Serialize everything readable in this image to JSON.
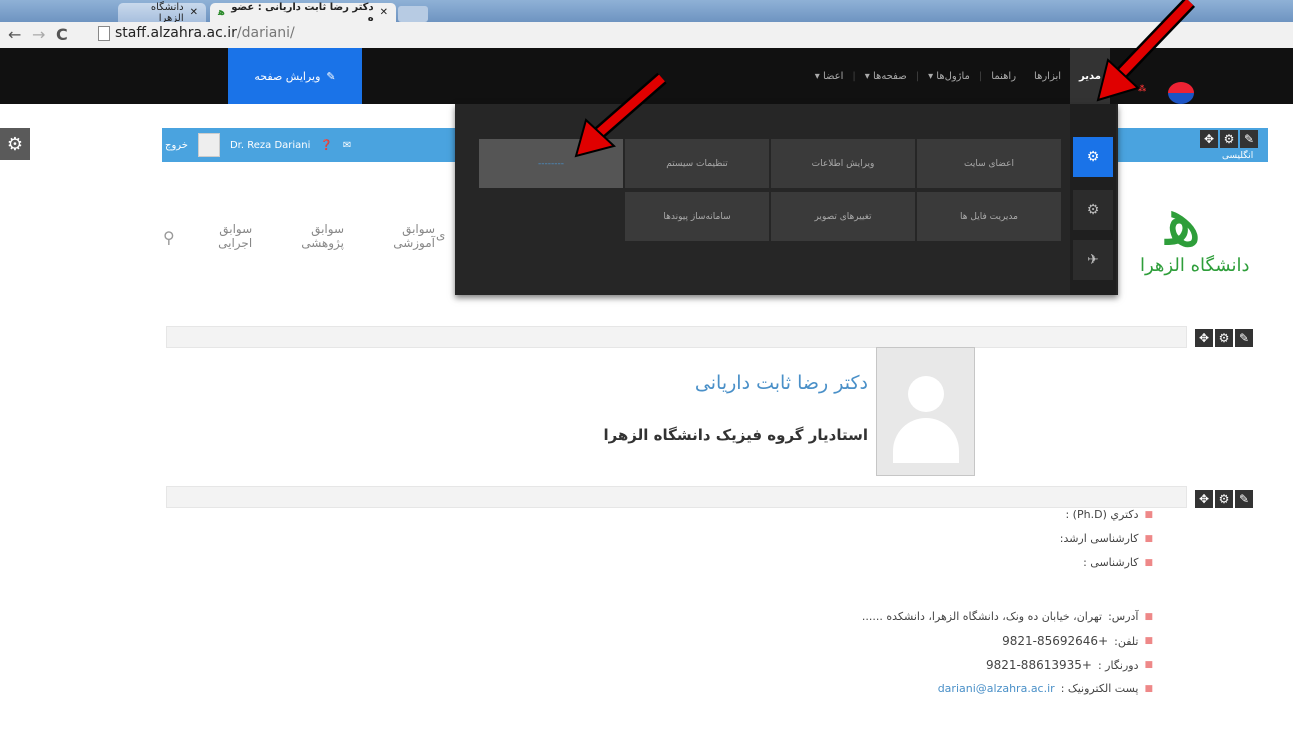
{
  "browser": {
    "tabs": [
      {
        "label": "دانشگاه الزهرا",
        "active": false
      },
      {
        "label": "دکتر رضا ثابت داریانی : عضو ه",
        "active": true
      }
    ],
    "url_domain": "staff.alzahra.ac.ir",
    "url_path": "/dariani/"
  },
  "adminbar": {
    "edit_page_label": "ویرایش صفحه",
    "menu": [
      "مدیر",
      "ابزارها",
      "راهنما",
      "ماژول‌ها",
      "صفحه‌ها",
      "اعضا"
    ],
    "active_item": "مدیر"
  },
  "userbar": {
    "logout": "خروج",
    "username": "Dr. Reza Dariani",
    "lang": "انگلیسی"
  },
  "dropdown": {
    "row1": [
      "اعضای سایت",
      "ویرایش اطلاعات",
      "تنظیمات سیستم",
      "--------"
    ],
    "row2": [
      "مدیریت فایل ها",
      "تغییرهای تصویر",
      "سامانه‌ساز پیوندها"
    ]
  },
  "site_logo": {
    "name": "دانشگاه الزهرا"
  },
  "nav": {
    "items": [
      "سوابق اجرایی",
      "سوابق پژوهشی",
      "سوابق آموزشی"
    ],
    "cut_item": "ی"
  },
  "profile": {
    "name": "دکتر رضا ثابت داریانی",
    "title": "استادیار گروه فیزیک دانشگاه الزهرا"
  },
  "info": {
    "phd": "دکتري (Ph.D) :",
    "masters": "کارشناسی ارشد:",
    "bachelor": "کارشناسی :",
    "address_label": "آدرس:",
    "address": "تهران، خیابان ده ونک، دانشگاه الزهرا، دانشکده ......",
    "phone_label": "تلفن:",
    "phone": "+9821-85692646",
    "fax_label": "دورنگار :",
    "fax": "+9821-88613935",
    "email_label": "پست الکترونیک :",
    "email": "dariani@alzahra.ac.ir"
  },
  "colors": {
    "admin_blue": "#1a73e8",
    "userbar_blue": "#4aa3df",
    "arrow_red": "#e00000",
    "logo_green": "#2e9e3a"
  }
}
